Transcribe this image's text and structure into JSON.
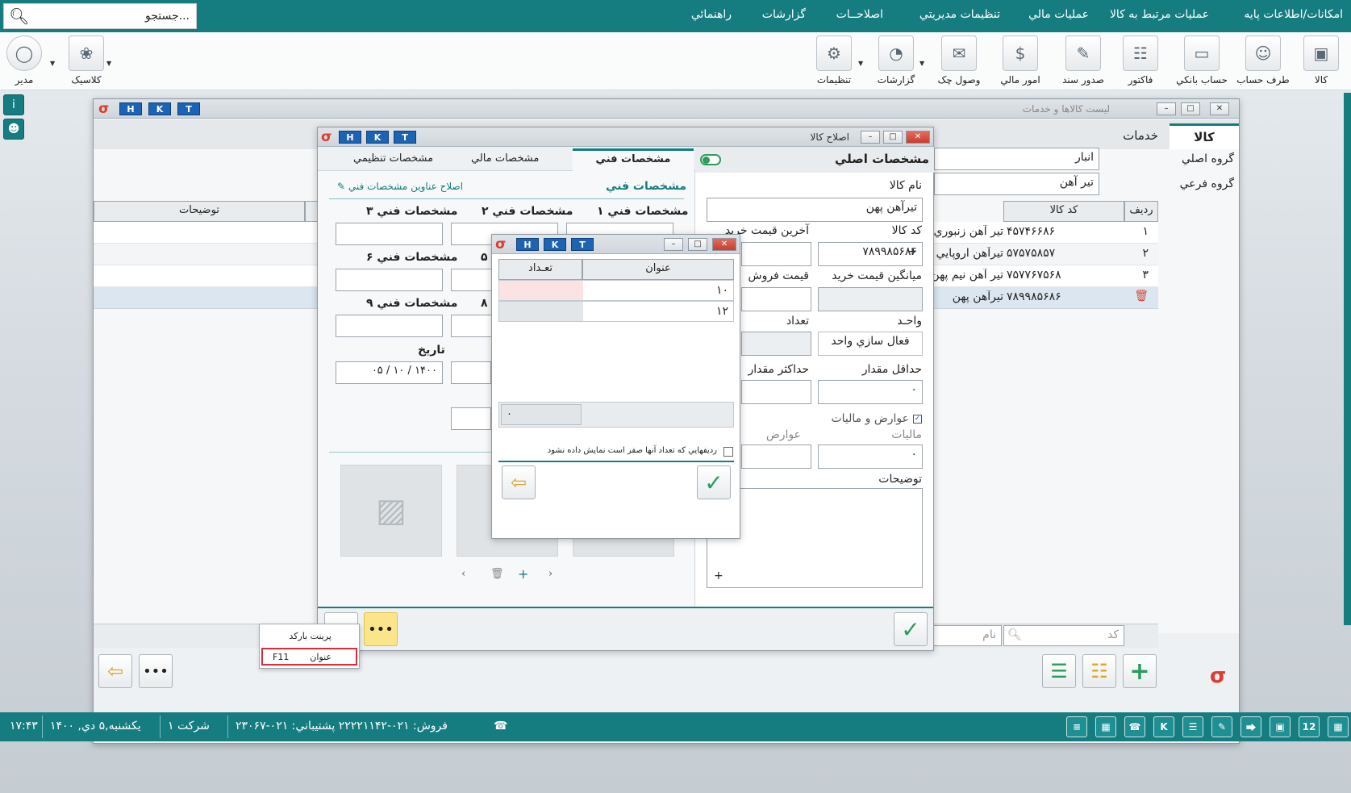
{
  "menubar": {
    "items": [
      "امکانات/اطلاعات پايه",
      "عمليات مرتبط به کالا",
      "عمليات مالي",
      "تنظيمات مديريتي",
      "اصلاحــات",
      "گزارشات",
      "راهنمائي"
    ],
    "search_placeholder": "جستجو..."
  },
  "toolbar": {
    "buttons": [
      "کالا",
      "طرف حساب",
      "حساب بانکي",
      "فاکتور",
      "صدور سند",
      "امور مالي",
      "وصول چک",
      "گزارشات",
      "تنظيمات",
      "کلاسيک",
      "مدير"
    ]
  },
  "list_window": {
    "title": "ليست کالاها و خدمات",
    "hkt": [
      "H",
      "K",
      "T"
    ],
    "tabs": [
      "کالا",
      "خدمات"
    ],
    "main_group_label": "گروه اصلي",
    "main_group_value": "انبار",
    "sub_group_label": "گروه فرعي",
    "sub_group_value": "تير آهن",
    "columns": [
      "رديف",
      "کد کالا",
      "توضيحات"
    ],
    "rows": [
      {
        "num": "۱",
        "code": "۴۵۷۴۶۶۸۶",
        "name": "تير آهن زنبوري"
      },
      {
        "num": "۲",
        "code": "۵۷۵۷۵۸۵۷",
        "name": "تيرآهن اروپايي"
      },
      {
        "num": "۳",
        "code": "۷۵۷۷۶۷۵۶۸",
        "name": "تير آهن نيم پهن"
      },
      {
        "num": "",
        "code": "۷۸۹۹۸۵۶۸۶",
        "name": "تيرآهن پهن"
      }
    ],
    "filter_code_placeholder": "کد",
    "filter_name_placeholder": "نام"
  },
  "edit_window": {
    "title": "اصلاح کالا",
    "main_specs_label": "مشخصات اصلي",
    "tabs": [
      "مشخصات فني",
      "مشخصات مالي",
      "مشخصات تنظيمي"
    ],
    "tech_header": "مشخصات فني",
    "edit_titles_link": "اصلاح عناوين مشخصات فني",
    "spec_labels": [
      "مشخصات فني ۱",
      "مشخصات فني ۲",
      "مشخصات فني ۳",
      "۵",
      "مشخصات فني ۶",
      "۸",
      "مشخصات فني ۹"
    ],
    "date_label": "تاريخ",
    "date_value": "۱۴۰۰  / ۱۰ /  ۰۵",
    "name_label": "نام کالا",
    "name_value": "تيرآهن پهن",
    "code_label": "کد کالا",
    "code_value": "۷۸۹۹۸۵۶۸۶",
    "last_buy_label": "آخرين قيمت خريد",
    "avg_buy_label": "ميانگين قيمت خريد",
    "sell_label": "قيمت فروش",
    "unit_label": "واحـد",
    "unit_button": "فعال سازي واحد",
    "count_label": "تعداد",
    "min_label": "حداقل مقدار",
    "min_value": "۰",
    "max_label": "حداکثر مقدار",
    "tax_check_label": "عوارض و ماليات",
    "tax_label": "ماليات",
    "tax_value": "۰",
    "toll_label": "عوارض",
    "desc_label": "توضيحات"
  },
  "popup_window": {
    "col_title": "عنوان",
    "col_count": "تعـداد",
    "rows": [
      {
        "title": "۱۰",
        "count": ""
      },
      {
        "title": "۱۲",
        "count": ""
      }
    ],
    "total": "۰",
    "hide_zero_label": "رديفهايي که تعداد آنها صفر است نمايش داده نشود"
  },
  "context_menu": {
    "items": [
      {
        "label": "پرينت بارکد",
        "shortcut": ""
      },
      {
        "label": "عنوان",
        "shortcut": "F11"
      }
    ]
  },
  "statusbar": {
    "time": "۱۷:۴۳",
    "date": "يکشنبه,۵ دي, ۱۴۰۰",
    "company": "شرکت ۱",
    "support": "فروش:  ۰۲۱-۲۲۲۲۱۱۴۲  پشتيباني: ۰۲۱-۲۳۰۶۷"
  },
  "colors": {
    "accent": "#157d80",
    "hkt": "#1d63b4",
    "close": "#c73d30",
    "selected_row": "#dce6f0",
    "highlight": "#fbe58a"
  }
}
